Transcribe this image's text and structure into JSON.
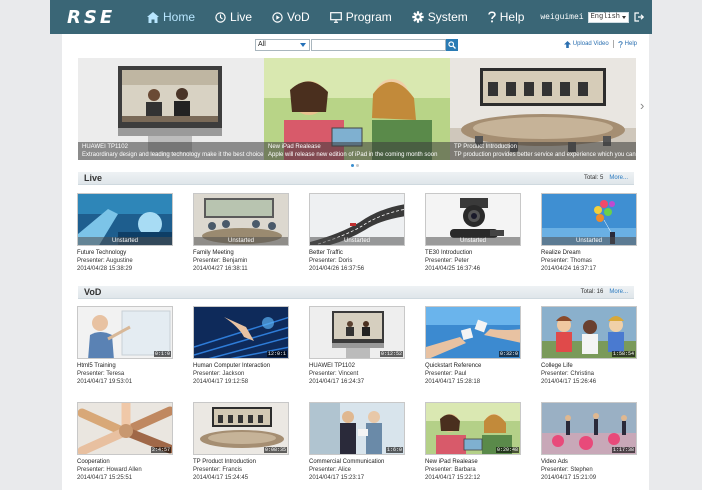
{
  "nav": {
    "logo": "RSE",
    "items": [
      {
        "label": "Home",
        "icon": "home-icon",
        "active": true
      },
      {
        "label": "Live",
        "icon": "clock-icon"
      },
      {
        "label": "VoD",
        "icon": "play-circle-icon"
      },
      {
        "label": "Program",
        "icon": "monitor-icon"
      },
      {
        "label": "System",
        "icon": "gear-icon"
      },
      {
        "label": "Help",
        "icon": "question-icon"
      }
    ],
    "user": "weiguimei",
    "language": "English",
    "accent": "#3a6676"
  },
  "search": {
    "scope": "All",
    "placeholder": ""
  },
  "toplinks": {
    "upload": "Upload Video",
    "help": "Help"
  },
  "banner": [
    {
      "title": "HUAWEI TP1102",
      "desc": "Extraordinary design and leading technology make it the best choice"
    },
    {
      "title": "New iPad Realease",
      "desc": "Apple will release new edition of iPad in the coming month soon"
    },
    {
      "title": "TP Product Introduction",
      "desc": "TP production provides better service and experience which you can"
    }
  ],
  "live": {
    "title": "Live",
    "total": "Total: 5",
    "more": "More...",
    "items": [
      {
        "title": "Future Technology",
        "presenter": "Presenter: Augustine",
        "date": "2014/04/28 15:38:29",
        "status": "Unstarted"
      },
      {
        "title": "Family Meeting",
        "presenter": "Presenter: Benjamin",
        "date": "2014/04/27 16:38:11",
        "status": "Unstarted"
      },
      {
        "title": "Better Traffic",
        "presenter": "Presenter: Doris",
        "date": "2014/04/26 16:37:56",
        "status": "Unstarted"
      },
      {
        "title": "TE30 Introduction",
        "presenter": "Presenter: Peter",
        "date": "2014/04/25 16:37:46",
        "status": "Unstarted"
      },
      {
        "title": "Realize Dream",
        "presenter": "Presenter: Thomas",
        "date": "2014/04/24 16:37:17",
        "status": "Unstarted"
      }
    ]
  },
  "vod": {
    "title": "VoD",
    "total": "Total: 16",
    "more": "More...",
    "items": [
      {
        "title": "Html5 Training",
        "presenter": "Presenter: Teresa",
        "date": "2014/04/17 19:53:01",
        "duration": "0:1:0"
      },
      {
        "title": "Human Computer Interaction",
        "presenter": "Presenter: Jackson",
        "date": "2014/04/17 19:12:58",
        "duration": "12:0:1"
      },
      {
        "title": "HUAWEI TP1102",
        "presenter": "Presenter: Vincent",
        "date": "2014/04/17 16:24:37",
        "duration": "0:12:52"
      },
      {
        "title": "Quickstart Reference",
        "presenter": "Presenter: Paul",
        "date": "2014/04/17 15:28:18",
        "duration": "0:32:0"
      },
      {
        "title": "College Life",
        "presenter": "Presenter: Christina",
        "date": "2014/04/17 15:26:46",
        "duration": "1:58:54"
      },
      {
        "title": "Cooperation",
        "presenter": "Presenter: Howard Allen",
        "date": "2014/04/17 15:25:51",
        "duration": "2:4:57"
      },
      {
        "title": "TP Product Introduction",
        "presenter": "Presenter: Francis",
        "date": "2014/04/17 15:24:45",
        "duration": "0:08:35"
      },
      {
        "title": "Commercial Communication",
        "presenter": "Presenter: Alice",
        "date": "2014/04/17 15:23:17",
        "duration": "1:6:0"
      },
      {
        "title": "New iPad Realease",
        "presenter": "Presenter: Barbara",
        "date": "2014/04/17 15:22:12",
        "duration": "0:20:48"
      },
      {
        "title": "Video Ads",
        "presenter": "Presenter: Stephen",
        "date": "2014/04/17 15:21:09",
        "duration": "1:17:38"
      }
    ]
  }
}
